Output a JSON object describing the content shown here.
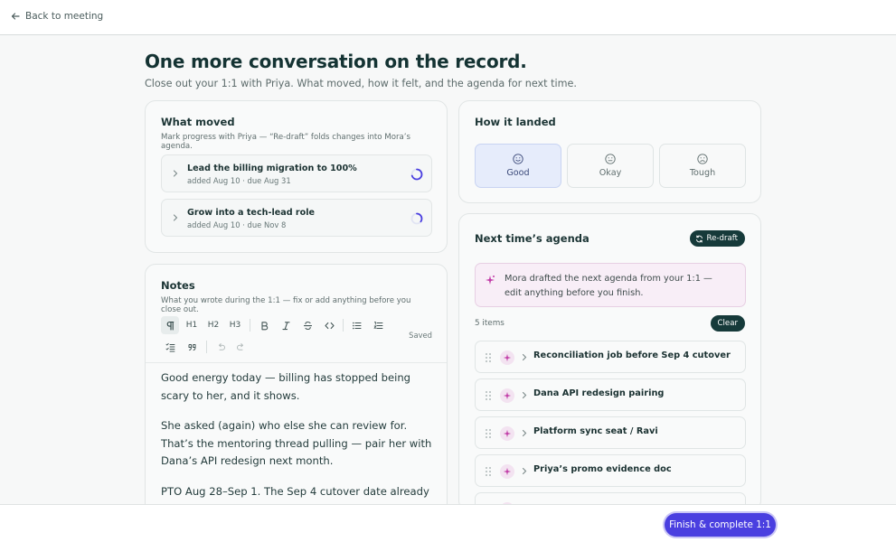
{
  "nav": {
    "back_label": "Back to meeting"
  },
  "header": {
    "title": "One more conversation on the record.",
    "subtitle": "Close out your 1:1 with Priya. What moved, how it felt, and the agenda for next time."
  },
  "what_moved": {
    "title": "What moved",
    "subtitle": "Mark progress with Priya — “Re-draft” folds changes into Mora’s agenda.",
    "goals": [
      {
        "title": "Lead the billing migration to 100%",
        "meta": "added Aug 10 · due Aug 31",
        "progress": 0.7
      },
      {
        "title": "Grow into a tech-lead role",
        "meta": "added Aug 10 · due Nov 8",
        "progress": 0.35
      }
    ]
  },
  "how_it_landed": {
    "title": "How it landed",
    "options": [
      {
        "label": "Good",
        "icon": "smile-icon",
        "selected": true
      },
      {
        "label": "Okay",
        "icon": "neutral-face-icon",
        "selected": false
      },
      {
        "label": "Tough",
        "icon": "frown-icon",
        "selected": false
      }
    ]
  },
  "notes": {
    "title": "Notes",
    "subtitle": "What you wrote during the 1:1 — fix or add anything before you close out.",
    "toolbar": {
      "h1": "H1",
      "h2": "H2",
      "h3": "H3",
      "saved_label": "Saved"
    },
    "paragraphs": [
      "Good energy today — billing has stopped being scary to her, and it shows.",
      "She asked (again) who else she can review for. That’s the mentoring thread pulling — pair her with Dana’s API redesign next month.",
      "PTO Aug 28–Sep 1. The Sep 4 cutover date already"
    ]
  },
  "agenda": {
    "title": "Next time’s agenda",
    "redraft_label": "Re-draft",
    "notice": "Mora drafted the next agenda from your 1:1 — edit anything before you finish.",
    "count_label": "5 items",
    "clear_label": "Clear",
    "items": [
      "Reconciliation job before Sep 4 cutover",
      "Dana API redesign pairing",
      "Platform sync seat / Ravi",
      "Priya’s promo evidence doc",
      ""
    ]
  },
  "footer": {
    "finish_label": "Finish & complete 1:1"
  },
  "colors": {
    "primary": "#4a3fe0",
    "dark_teal": "#163a3a",
    "ai_accent": "#c13ca7",
    "selected_mood": "#e6ecfb"
  }
}
